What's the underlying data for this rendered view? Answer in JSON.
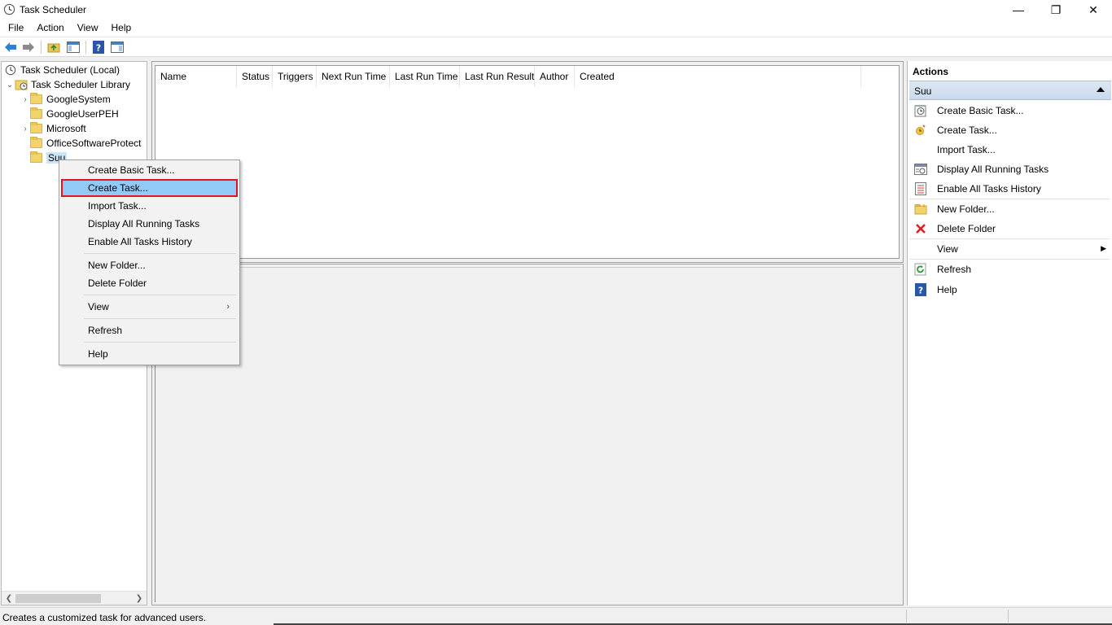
{
  "window": {
    "title": "Task Scheduler",
    "controls": {
      "minimize": "—",
      "restore": "❐",
      "close": "✕"
    }
  },
  "menubar": {
    "items": [
      "File",
      "Action",
      "View",
      "Help"
    ]
  },
  "toolbar": {
    "icons": [
      "back-arrow-icon",
      "forward-arrow-icon",
      "up-folder-icon",
      "show-hide-console-tree-icon",
      "help-icon",
      "show-hide-action-pane-icon"
    ]
  },
  "tree": {
    "root": "Task Scheduler (Local)",
    "library": "Task Scheduler Library",
    "folders": [
      {
        "label": "GoogleSystem",
        "expandable": true
      },
      {
        "label": "GoogleUserPEH",
        "expandable": false
      },
      {
        "label": "Microsoft",
        "expandable": true
      },
      {
        "label": "OfficeSoftwareProtect",
        "expandable": false
      },
      {
        "label": "Suu",
        "expandable": false,
        "selected": true
      }
    ]
  },
  "task_list": {
    "columns": [
      "Name",
      "Status",
      "Triggers",
      "Next Run Time",
      "Last Run Time",
      "Last Run Result",
      "Author",
      "Created"
    ]
  },
  "context_menu": {
    "items": [
      {
        "label": "Create Basic Task..."
      },
      {
        "label": "Create Task...",
        "highlighted": true
      },
      {
        "label": "Import Task..."
      },
      {
        "label": "Display All Running Tasks"
      },
      {
        "label": "Enable All Tasks History"
      },
      {
        "label": "New Folder..."
      },
      {
        "label": "Delete Folder"
      },
      {
        "label": "View",
        "submenu": true
      },
      {
        "label": "Refresh"
      },
      {
        "label": "Help"
      }
    ],
    "submenu_arrow": "›"
  },
  "actions": {
    "title": "Actions",
    "section": "Suu",
    "items": [
      {
        "label": "Create Basic Task...",
        "icon": "create-basic-task-icon"
      },
      {
        "label": "Create Task...",
        "icon": "create-task-icon"
      },
      {
        "label": "Import Task...",
        "icon": ""
      },
      {
        "label": "Display All Running Tasks",
        "icon": "running-tasks-icon"
      },
      {
        "label": "Enable All Tasks History",
        "icon": "tasks-history-icon"
      },
      {
        "label": "New Folder...",
        "icon": "new-folder-icon"
      },
      {
        "label": "Delete Folder",
        "icon": "delete-icon"
      },
      {
        "label": "View",
        "icon": "",
        "submenu": true
      },
      {
        "label": "Refresh",
        "icon": "refresh-icon"
      },
      {
        "label": "Help",
        "icon": "help-icon"
      }
    ],
    "submenu_arrow": "▶"
  },
  "statusbar": {
    "text": "Creates a customized task for advanced users."
  },
  "colors": {
    "highlight": "#91c9f7",
    "highlight_border": "#e81123",
    "selected_tree": "#cce4f7"
  }
}
